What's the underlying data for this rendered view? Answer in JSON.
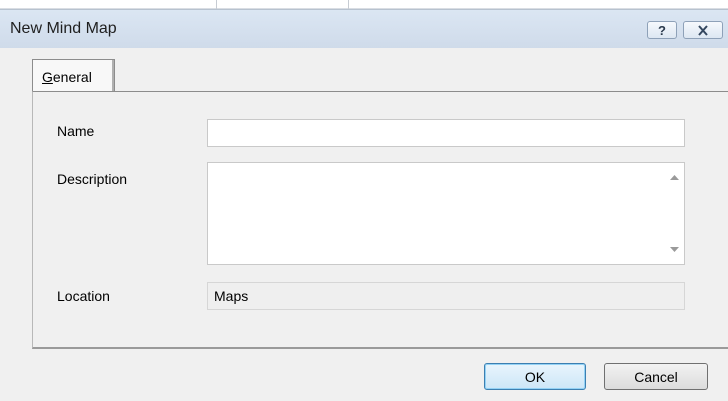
{
  "dialog": {
    "title": "New Mind Map",
    "help_button_glyph": "?",
    "close_button_glyph": "X"
  },
  "tabs": [
    {
      "label_prefix": "G",
      "label_rest": "eneral",
      "selected": true
    }
  ],
  "form": {
    "name_label": "Name",
    "name_value": "",
    "description_label": "Description",
    "description_value": "",
    "location_label": "Location",
    "location_value": "Maps"
  },
  "buttons": {
    "ok_label": "OK",
    "cancel_label": "Cancel"
  },
  "colors": {
    "titlebar": "#cfdbea",
    "dialog_bg": "#f0f0f0",
    "default_button_border": "#3c7fb1"
  }
}
